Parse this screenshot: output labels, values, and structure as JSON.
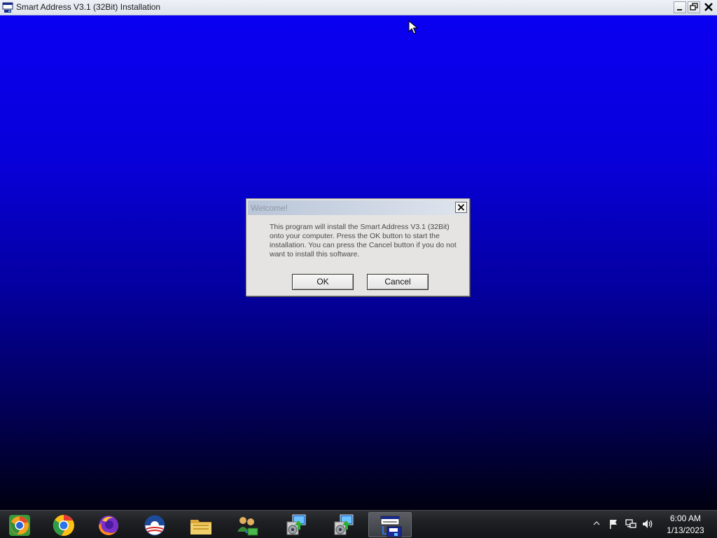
{
  "window": {
    "title": "Smart Address V3.1 (32Bit) Installation",
    "minimize_glyph": "_",
    "restore_glyph": "❐",
    "close_glyph": "✕"
  },
  "dialog": {
    "title": "Welcome!",
    "message": "This program will install the Smart Address V3.1 (32Bit) onto your computer. Press the OK button to start the installation. You can press the Cancel button if you do not want to install this software.",
    "ok_label": "OK",
    "cancel_label": "Cancel",
    "close_glyph": "✕"
  },
  "taskbar": {
    "items": [
      {
        "icon": "chrome-canary-icon"
      },
      {
        "icon": "chrome-icon"
      },
      {
        "icon": "firefox-icon"
      },
      {
        "icon": "obama-logo-icon"
      },
      {
        "icon": "file-explorer-icon"
      },
      {
        "icon": "network-users-icon"
      },
      {
        "icon": "installer-icon"
      },
      {
        "icon": "installer-icon"
      },
      {
        "icon": "setup-window-icon",
        "active": true
      }
    ],
    "tray": {
      "icons": [
        "show-hidden-icon",
        "action-center-flag-icon",
        "network-icon",
        "volume-icon"
      ],
      "time": "6:00 AM",
      "date": "1/13/2023"
    }
  },
  "colors": {
    "background_top": "#0a00f2",
    "background_bottom": "#000010",
    "taskbar": "#1e2023",
    "dialog": "#e6e4e2"
  }
}
